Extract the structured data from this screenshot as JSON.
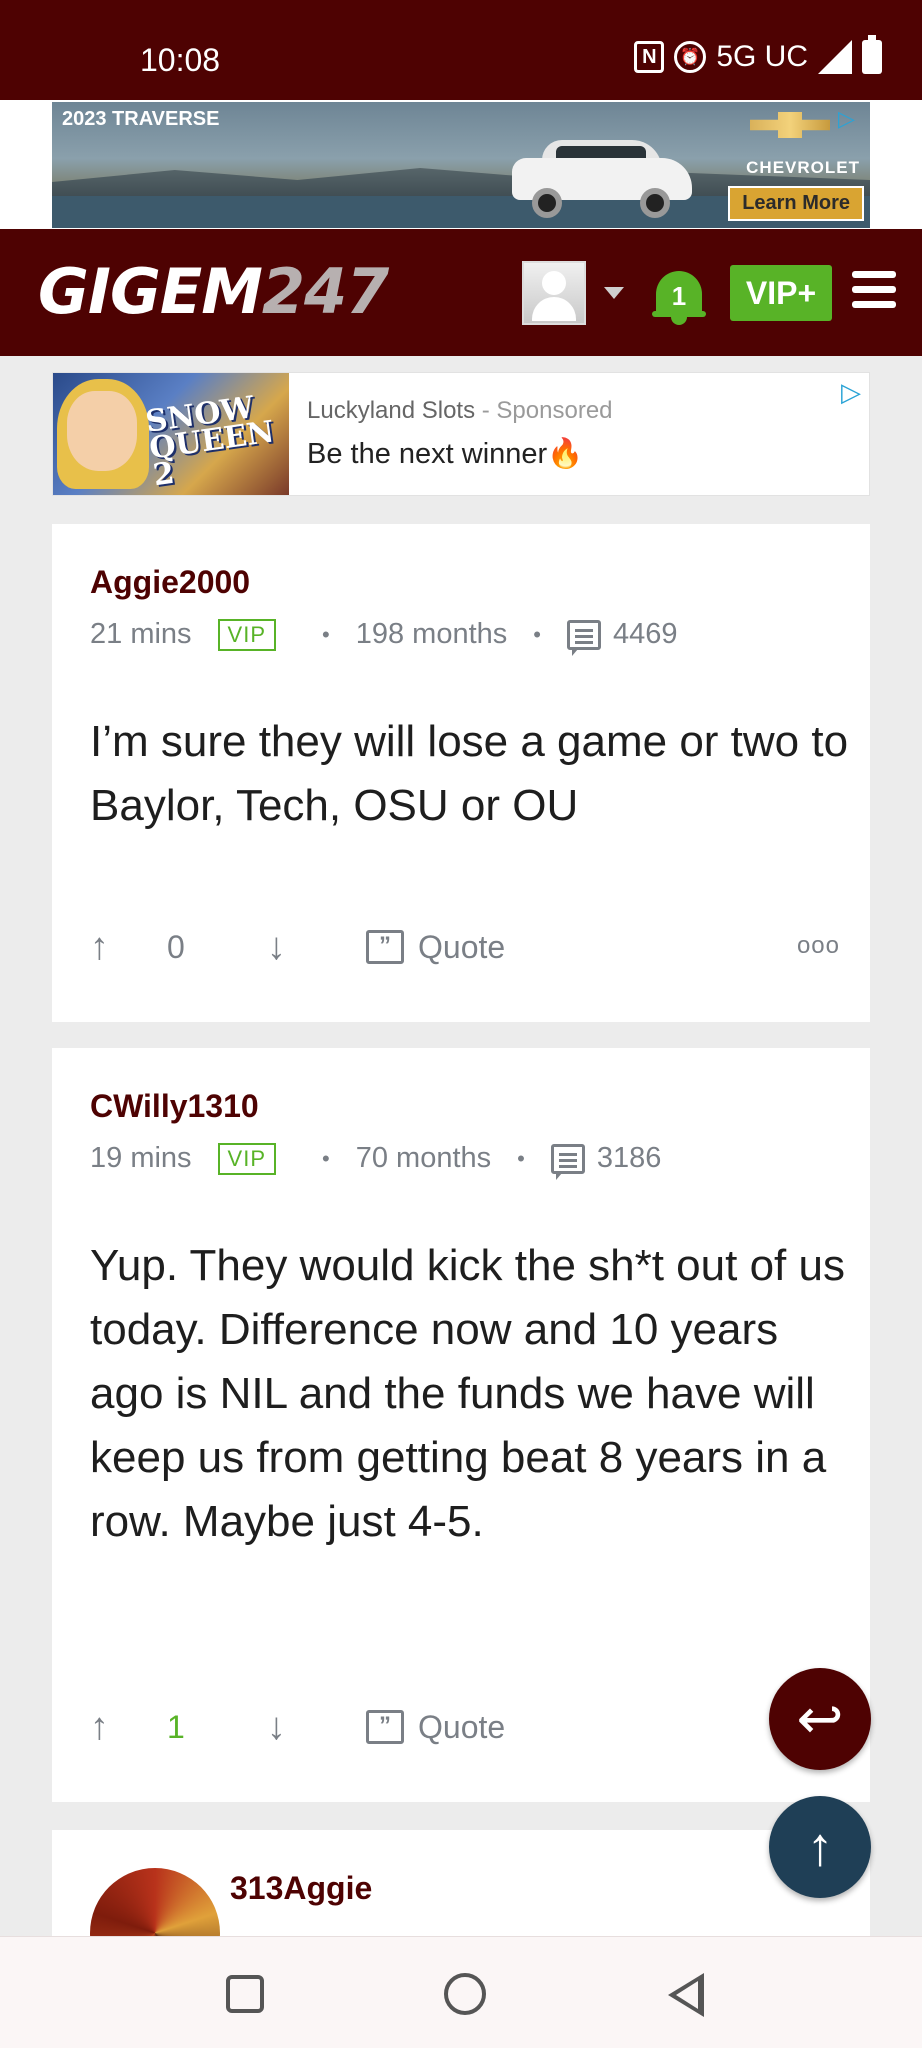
{
  "status_bar": {
    "time": "10:08",
    "network": "5G UC"
  },
  "top_ad": {
    "headline": "2023 TRAVERSE",
    "brand": "CHEVROLET",
    "cta": "Learn More"
  },
  "site_header": {
    "logo_main": "GIGEM",
    "logo_num": "247",
    "notification_count": "1",
    "vip_label": "VIP+"
  },
  "sponsored": {
    "source": "Luckyland Slots",
    "tag": " - Sponsored",
    "headline": "Be the next winner🔥",
    "image_title": "Snow Queen 2"
  },
  "posts": [
    {
      "author": "Aggie2000",
      "time": "21 mins",
      "badge": "VIP",
      "tenure": "198 months",
      "post_count": "4469",
      "body": "I’m sure they will lose a game or two to Baylor, Tech, OSU or OU",
      "votes": "0",
      "quote_label": "Quote",
      "more_label": "ooo"
    },
    {
      "author": "CWilly1310",
      "time": "19 mins",
      "badge": "VIP",
      "tenure": "70 months",
      "post_count": "3186",
      "body": "Yup. They would kick the sh*t out of us today. Difference now and 10 years ago is NIL and the funds we have will keep us from getting beat 8 years in a row. Maybe just 4-5.",
      "votes": "1",
      "quote_label": "Quote"
    },
    {
      "author": "313Aggie"
    }
  ],
  "colors": {
    "brand": "#4e0202",
    "accent_green": "#58b327",
    "scroll_top_fab": "#1f3f56"
  }
}
